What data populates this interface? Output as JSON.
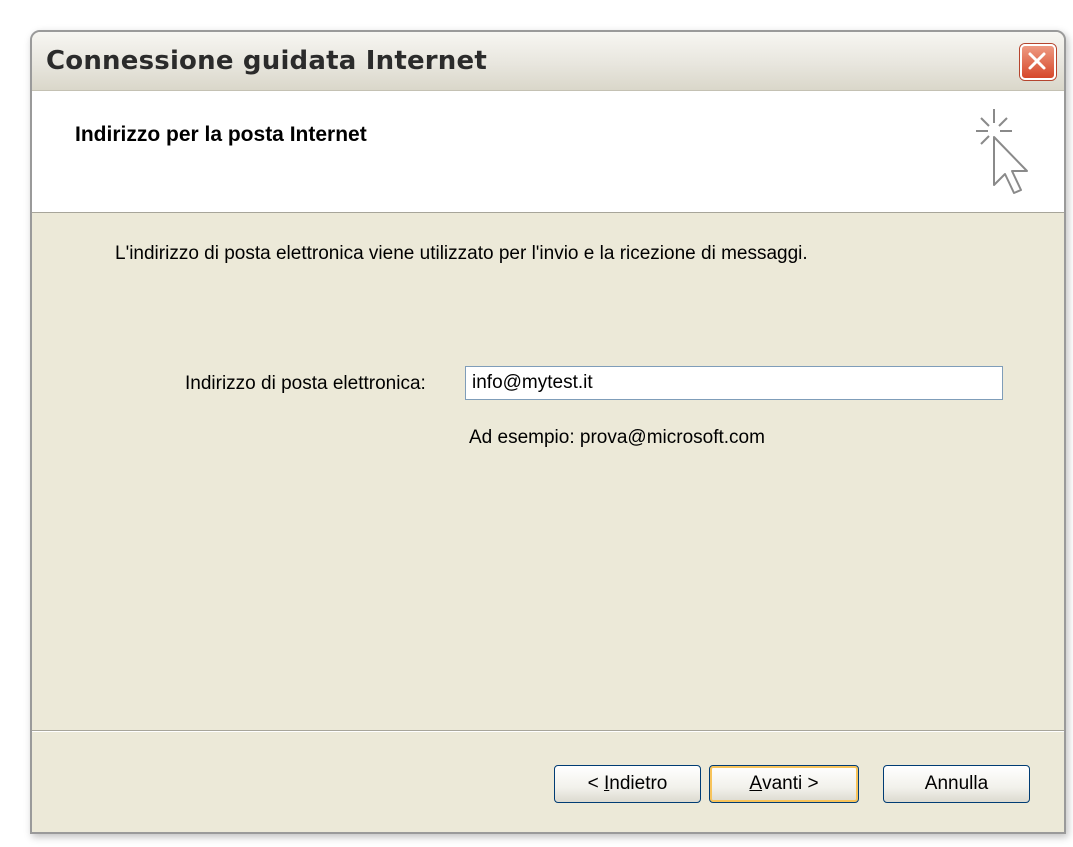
{
  "window": {
    "title": "Connessione guidata Internet",
    "close_icon": "close-icon"
  },
  "header": {
    "title": "Indirizzo per la posta Internet",
    "icon": "wizard-cursor-icon"
  },
  "body": {
    "description": "L'indirizzo di posta elettronica viene utilizzato per l'invio e la ricezione di messaggi.",
    "email_label": "Indirizzo di posta elettronica:",
    "email_value": "info@mytest.it",
    "example": "Ad esempio: prova@microsoft.com"
  },
  "buttons": {
    "back_prefix": "< ",
    "back_mnemonic": "I",
    "back_rest": "ndietro",
    "next_mnemonic": "A",
    "next_rest": "vanti >",
    "cancel": "Annulla"
  },
  "colors": {
    "accent": "#d6472a",
    "dialog_bg": "#ece9d8",
    "input_border": "#7f9db9",
    "default_button_highlight": "#f7c35a"
  }
}
